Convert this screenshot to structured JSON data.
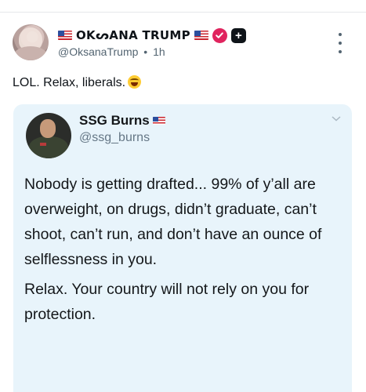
{
  "post": {
    "display_name": "OKᔕANA TRUMP",
    "handle": "@OksanaTrump",
    "separator": "•",
    "time": "1h",
    "badge_plus": "+",
    "text": "LOL. Relax, liberals."
  },
  "embedded_tweet": {
    "name": "SSG Burns",
    "handle": "@ssg_burns",
    "paragraphs": [
      "Nobody is getting drafted... 99% of y’all are overweight, on drugs, didn’t graduate, can’t shoot, can’t run, and don’t have an ounce of selflessness in you.",
      "Relax. Your country will not rely on you for protection."
    ]
  },
  "icons": {
    "flag": "us-flag-icon",
    "verified": "verified-badge-icon",
    "more": "more-options-icon",
    "emoji": "laughing-tears-emoji",
    "chevron": "chevron-down-icon"
  },
  "colors": {
    "verified_badge": "#e0245e",
    "embed_background": "#e8f4fb",
    "secondary_text": "#536471"
  }
}
